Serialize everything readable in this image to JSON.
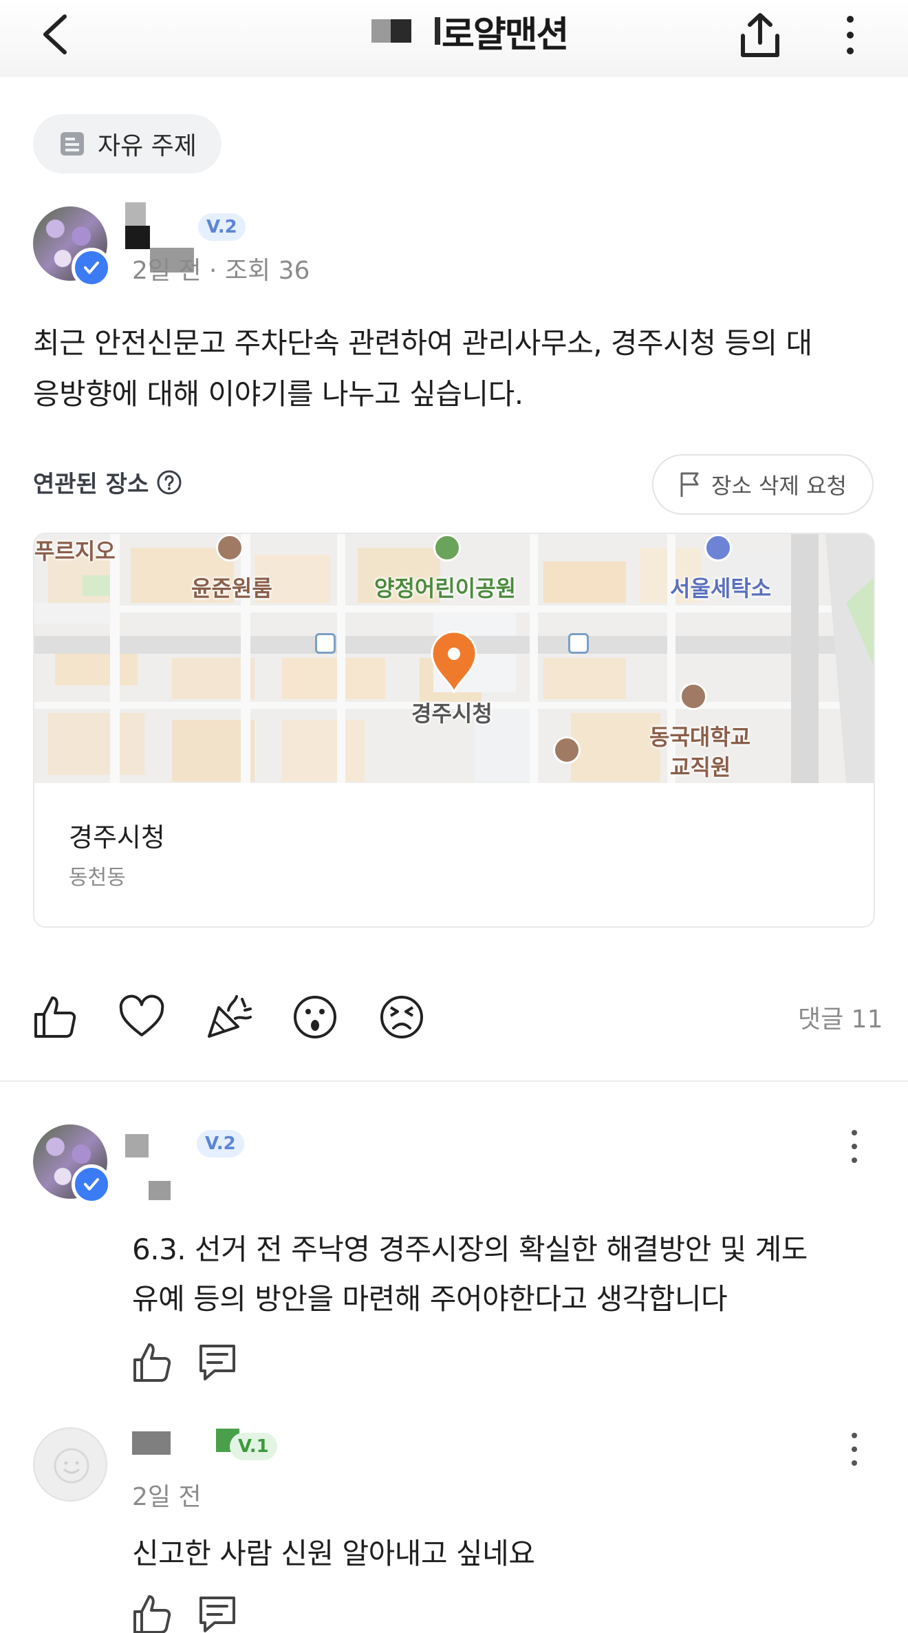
{
  "header": {
    "title": "로얄맨션",
    "back_icon": "chevron-left-icon",
    "share_icon": "share-icon",
    "more_icon": "more-vertical-icon"
  },
  "topic": {
    "label": "자유 주제",
    "icon": "document-icon"
  },
  "post": {
    "author_level": "V.2",
    "meta": "2일 전 · 조회 36",
    "body_line1": "최근 안전신문고 주차단속 관련하여 관리사무소, 경주시청 등의 대",
    "body_line2": "응방향에 대해 이야기를 나누고 싶습니다."
  },
  "related_place": {
    "label": "연관된 장소",
    "delete_request": "장소 삭제 요청",
    "map_labels": {
      "a": "푸르지오",
      "b": "윤준원룸",
      "c": "양정어린이공원",
      "d": "서울세탁소",
      "e": "경주시청",
      "f": "동국대학교",
      "g": "교직원"
    },
    "place_name": "경주시청",
    "place_area": "동천동"
  },
  "reactions": {
    "items": [
      "thumbs-up-icon",
      "heart-icon",
      "party-icon",
      "surprised-icon",
      "angry-icon"
    ],
    "comment_count": "댓글 11"
  },
  "comments": [
    {
      "level": "V.2",
      "line1": "6.3. 선거 전 주낙영 경주시장의 확실한 해결방안 및 계도",
      "line2": "유예 등의 방안을 마련해 주어야한다고 생각합니다"
    },
    {
      "level": "V.1",
      "time": "2일 전",
      "line1": "신고한 사람 신원 알아내고 싶네요"
    }
  ],
  "colors": {
    "accent_blue": "#3b7cf6",
    "pin_orange": "#f07a2c",
    "map_bg": "#efeeec"
  }
}
